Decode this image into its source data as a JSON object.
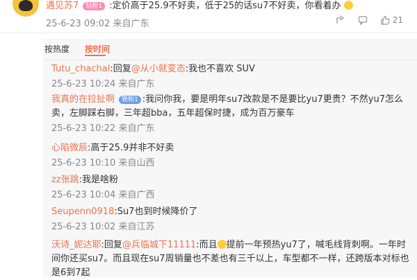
{
  "main": {
    "username": "遇见苏7",
    "badge": "钻粉1",
    "text": ":定价高于25.9不好卖，低于25的话su7不好卖，你看着办",
    "time": "25-6-23 09:02",
    "location": "来自广东",
    "like_count": "21"
  },
  "sort": {
    "hot": "按热度",
    "time": "按时间"
  },
  "replies": [
    {
      "user": "Tutu_chachal",
      "prefix": ":回复",
      "at": "@从小就变态",
      "text": ":我也不喜欢 SUV",
      "time": "25-6-23 10:24",
      "location": "来自广东"
    },
    {
      "user": "我真的在拉扯啊",
      "badge": "铁粉1",
      "text": ":我问你我，要是明年su7改款是不是要比yu7更贵？不然yu7怎么卖，左脚踩右脚，三年超bba，五年超保时捷，成为百万豪车",
      "time": "25-6-23 10:22",
      "location": "来自广东"
    },
    {
      "user": "心陷微辰",
      "text": ":高于25.9并非不好卖",
      "time": "25-6-23 10:10",
      "location": "来自山西"
    },
    {
      "user": "zz张跳",
      "text": ":我是啥粉",
      "time": "25-6-23 10:04",
      "location": "来自广西"
    },
    {
      "user": "Seupenn0918",
      "text": ":Su7也到时候降价了",
      "time": "25-6-23 10:02",
      "location": "来自江苏"
    },
    {
      "user": "沃诗_妮达耶",
      "prefix": ":回复",
      "at": "@兵临城下11111",
      "text1": ":而且",
      "text2": "提前一年预热yu7了，喊毛线背刺啊。一年时间你还买su7。而且现在su7周销量也不差也有三千以上，车型都不一样，还跨版本对标也是6到7起"
    }
  ]
}
